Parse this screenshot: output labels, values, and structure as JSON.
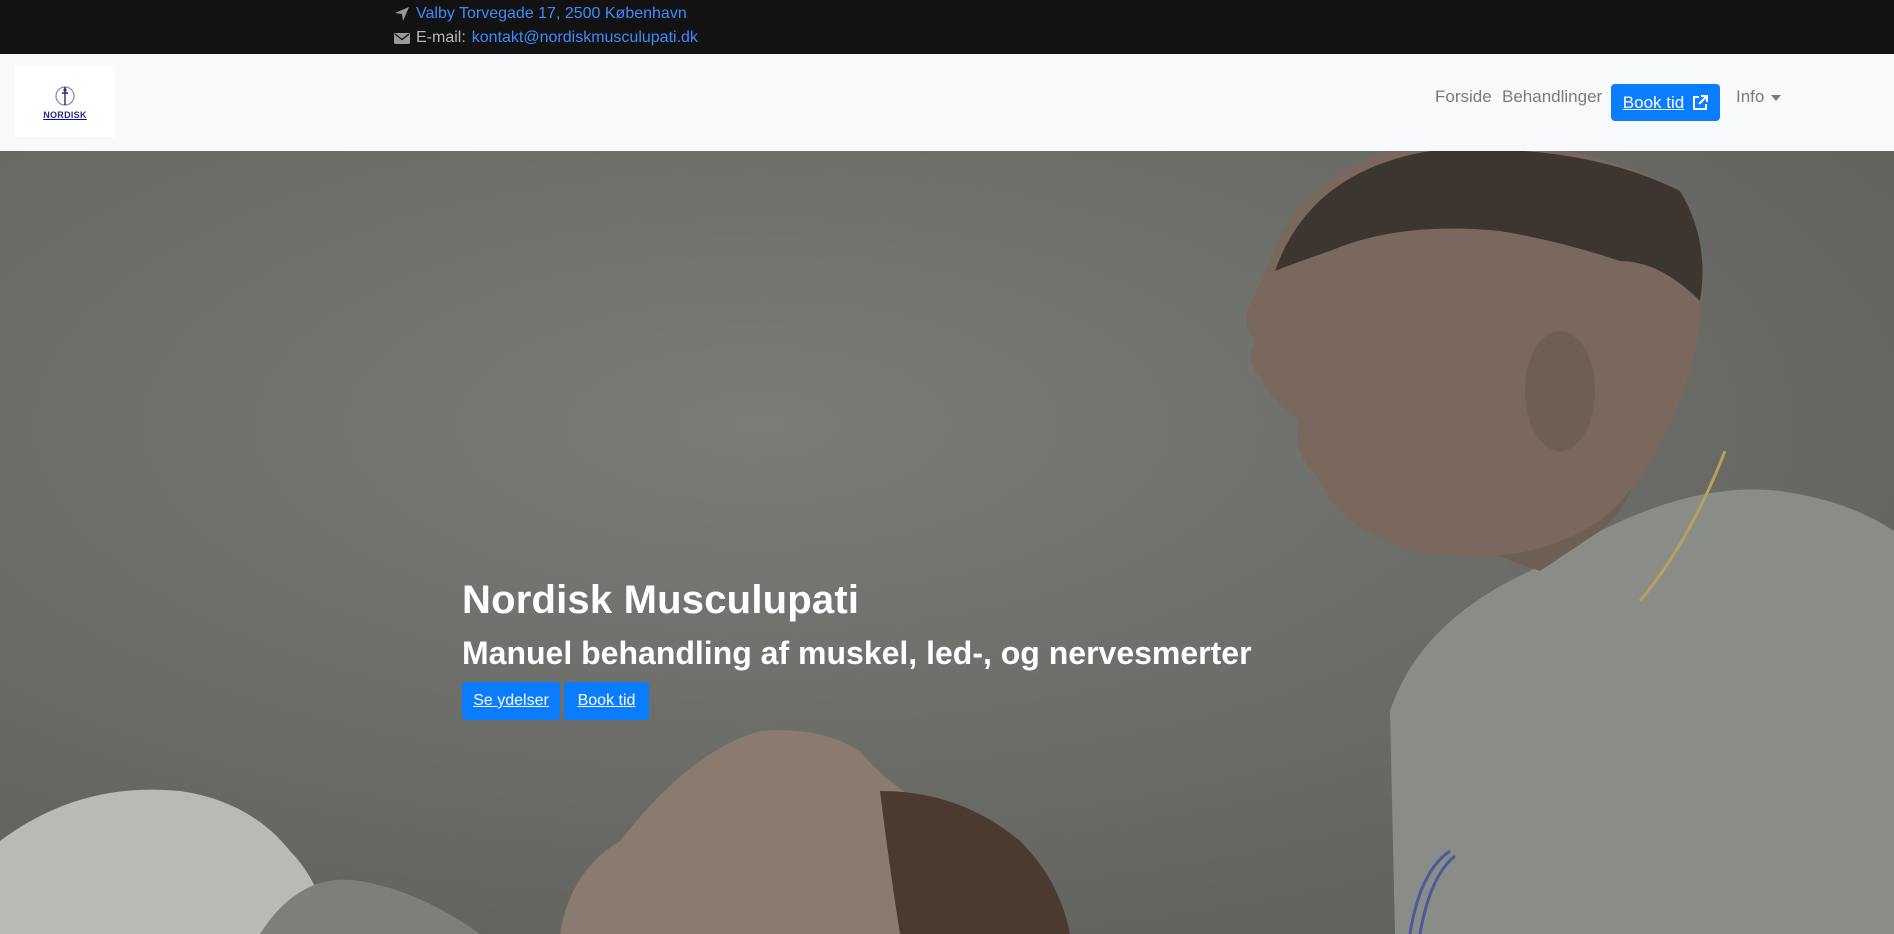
{
  "topbar": {
    "address_icon": "location-arrow-icon",
    "address": "Valby Torvegade 17, 2500 København",
    "email_icon": "envelope-icon",
    "email_label": "E-mail:",
    "email": "kontakt@nordiskmusculupati.dk"
  },
  "navbar": {
    "logo_text": "NORDISK",
    "items": [
      {
        "label": "Forside"
      },
      {
        "label": "Behandlinger"
      }
    ],
    "book_label": "Book tid",
    "book_icon": "external-link-icon",
    "info_label": "Info"
  },
  "hero": {
    "title": "Nordisk Musculupati",
    "subtitle": "Manuel behandling af muskel, led-, og nervesmerter",
    "primary_button": "Se ydelser",
    "secondary_button": "Book tid"
  },
  "colors": {
    "accent": "#0a7cff",
    "topbar_bg": "#121212",
    "navbar_bg": "#f8f9fa",
    "link": "#3d8bfd"
  }
}
